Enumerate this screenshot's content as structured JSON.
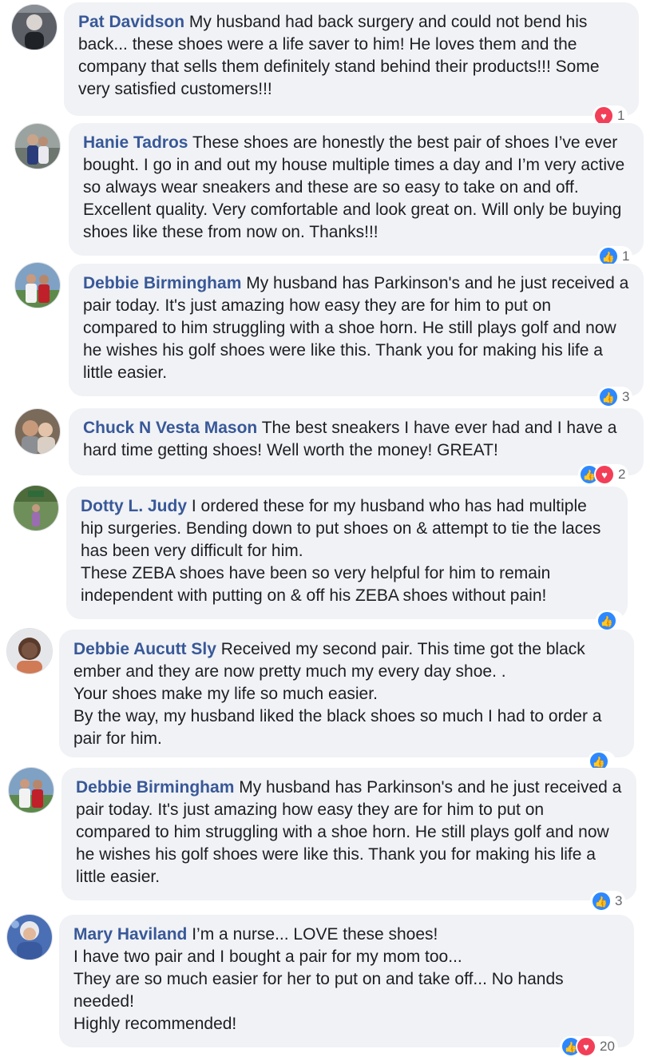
{
  "colors": {
    "author_link": "#385898",
    "bubble_bg": "#f0f2f5",
    "like": "#2d88ff",
    "love": "#f33e58"
  },
  "comments": [
    {
      "author": "Pat Davidson",
      "text": " My husband had back surgery and could not bend his back... these shoes were a life saver to him! He loves them and the company that sells them definitely stand behind their products!!! Some very satisfied customers!!!",
      "reactions": [
        "love"
      ],
      "reaction_count": "1"
    },
    {
      "author": "Hanie Tadros",
      "text": " These shoes are honestly the best pair of shoes I’ve ever bought. I go in and out my house multiple times a day and I’m very active so always wear sneakers and these are so easy to take on and off. Excellent quality. Very comfortable and look great on. Will only be buying shoes like these from now on. Thanks!!!",
      "reactions": [
        "like"
      ],
      "reaction_count": "1"
    },
    {
      "author": "Debbie Birmingham",
      "text": " My husband has Parkinson's and he just received a pair today. It's just amazing how easy they are for him to put on compared to him struggling with a shoe horn. He still plays golf and now he wishes his golf shoes were like this. Thank you for making his life a little easier.",
      "reactions": [
        "like"
      ],
      "reaction_count": "3"
    },
    {
      "author": "Chuck N Vesta Mason",
      "text": " The best sneakers I have ever had and I have a hard time getting shoes! Well worth the money! GREAT!",
      "reactions": [
        "like",
        "love"
      ],
      "reaction_count": "2"
    },
    {
      "author": "Dotty L. Judy",
      "text": " I ordered these for my husband who has had multiple hip surgeries. Bending down to put shoes on & attempt to tie the laces has been very difficult for him.\nThese ZEBA shoes have been so very helpful for him to remain independent with putting on & off his ZEBA shoes without pain!",
      "reactions": [
        "like"
      ],
      "reaction_count": ""
    },
    {
      "author": "Debbie Aucutt Sly",
      "text": " Received my second pair. This time got the black ember and they are now pretty much my every day shoe. .\nYour shoes make my life so much easier.\nBy the way, my husband liked the black shoes so much I had to order a pair for him.",
      "reactions": [
        "like"
      ],
      "reaction_count": ""
    },
    {
      "author": "Debbie Birmingham",
      "text": " My husband has Parkinson's and he just received a pair today. It's just amazing how easy they are for him to put on compared to him struggling with a shoe horn. He still plays golf and now he wishes his golf shoes were like this. Thank you for making his life a little easier.",
      "reactions": [
        "like"
      ],
      "reaction_count": "3"
    },
    {
      "author": "Mary Haviland",
      "text": " I’m a nurse... LOVE these shoes!\nI have two pair and I bought a pair for my mom too...\nThey are so much easier for her to put on and take off... No hands needed!\nHighly recommended!",
      "reactions": [
        "like",
        "love"
      ],
      "reaction_count": "20"
    }
  ]
}
